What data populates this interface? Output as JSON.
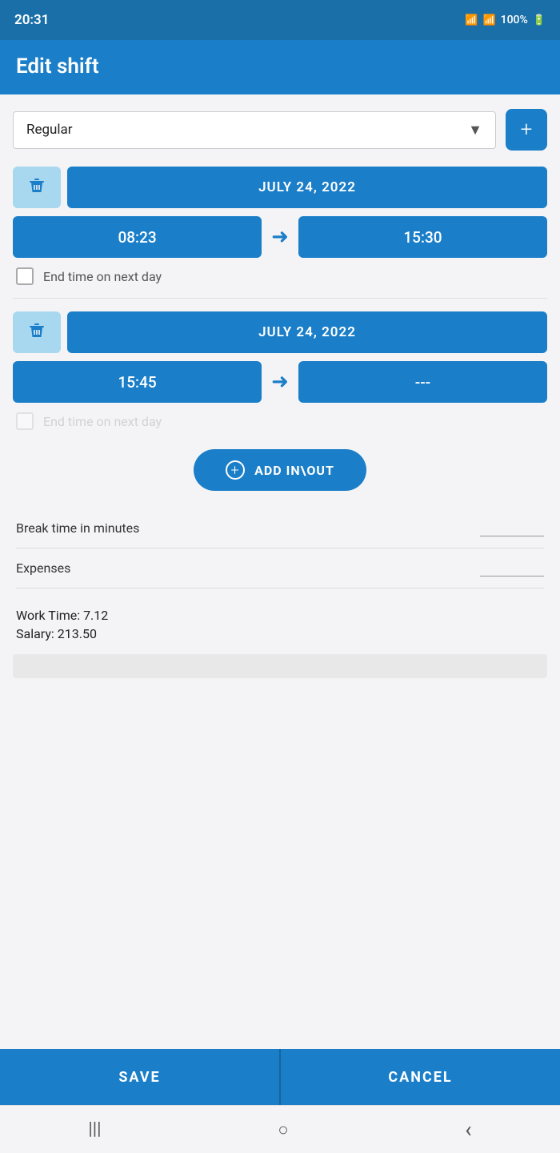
{
  "statusBar": {
    "time": "20:31",
    "battery": "100%",
    "wifi": "WiFi",
    "signal": "Signal"
  },
  "header": {
    "title": "Edit shift"
  },
  "shiftType": {
    "label": "Regular",
    "addLabel": "+"
  },
  "shift1": {
    "date": "JULY 24, 2022",
    "startTime": "08:23",
    "endTime": "15:30",
    "endNextDay": "End time on next day"
  },
  "shift2": {
    "date": "JULY 24, 2022",
    "startTime": "15:45",
    "endTime": "---",
    "endNextDay": "End time on next day"
  },
  "addButton": {
    "label": "ADD IN\\OUT"
  },
  "breakTime": {
    "label": "Break time in minutes",
    "value": ""
  },
  "expenses": {
    "label": "Expenses",
    "value": ""
  },
  "workInfo": {
    "workTime": "Work Time: 7.12",
    "salary": "Salary: 213.50"
  },
  "buttons": {
    "save": "SAVE",
    "cancel": "CANCEL"
  },
  "nav": {
    "menu": "|||",
    "home": "○",
    "back": "‹"
  }
}
